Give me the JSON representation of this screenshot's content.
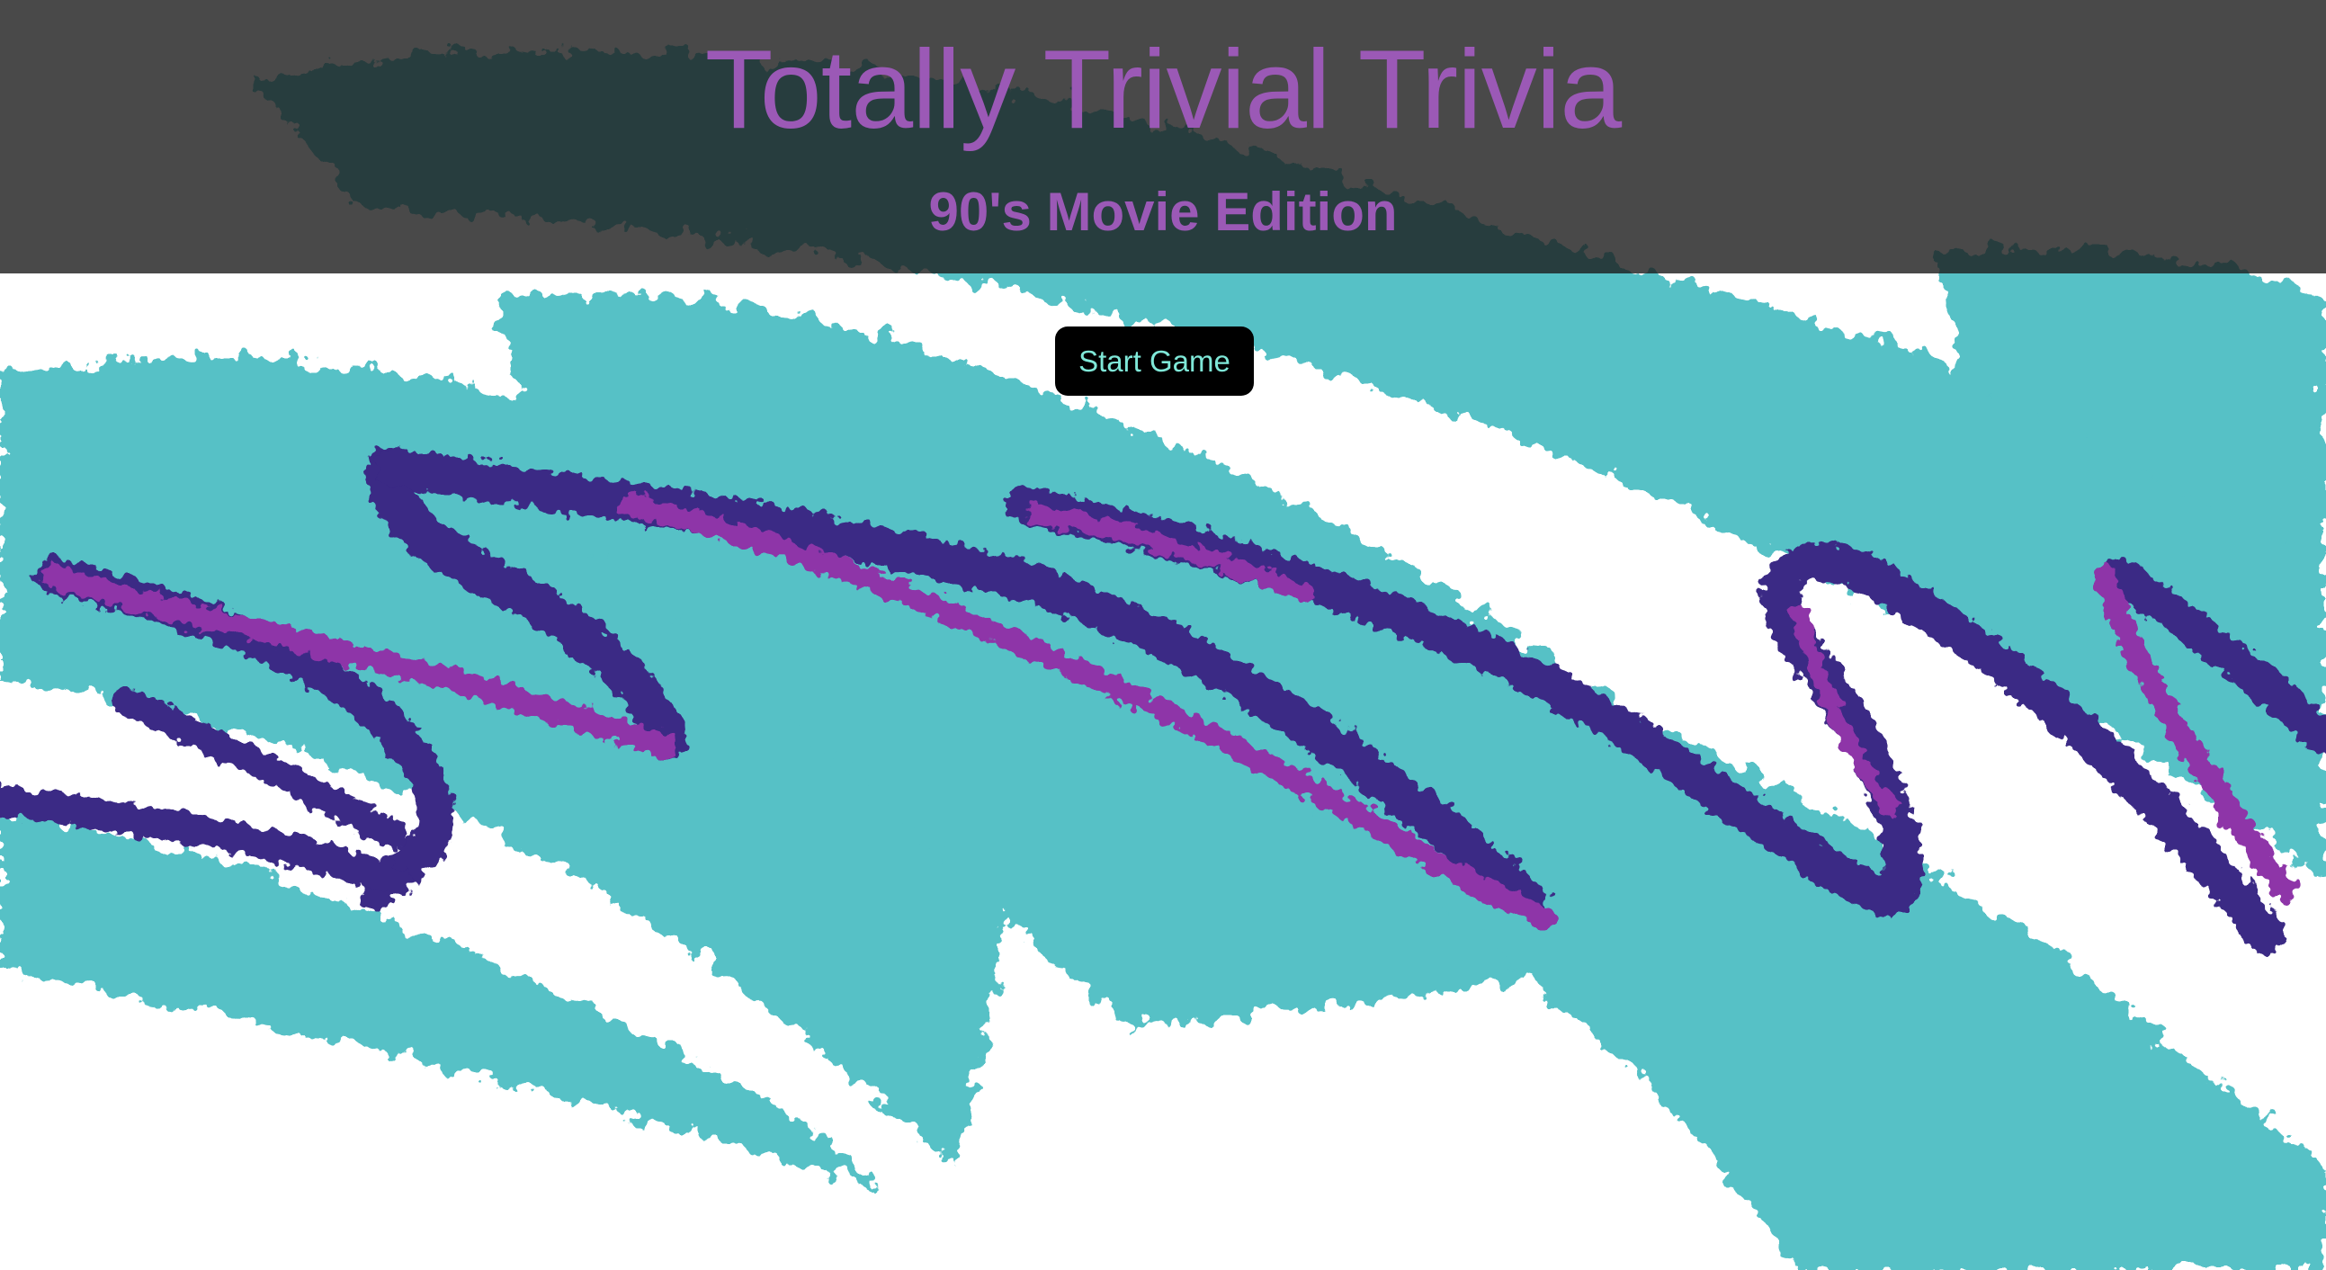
{
  "app": {
    "title": "Totally Trivial Trivia",
    "subtitle": "90's Movie Edition"
  },
  "controls": {
    "start_label": "Start Game"
  },
  "colors": {
    "title": "#9b59b6",
    "button_bg": "#000000",
    "button_text": "#7fe8d8",
    "header_overlay": "#2e2e2e",
    "pattern_teal": "#56c1c6",
    "pattern_navy": "#3a2985",
    "pattern_magenta": "#8e35a8",
    "page_bg": "#ffffff"
  },
  "background": {
    "pattern": "90s cup wave pattern"
  }
}
